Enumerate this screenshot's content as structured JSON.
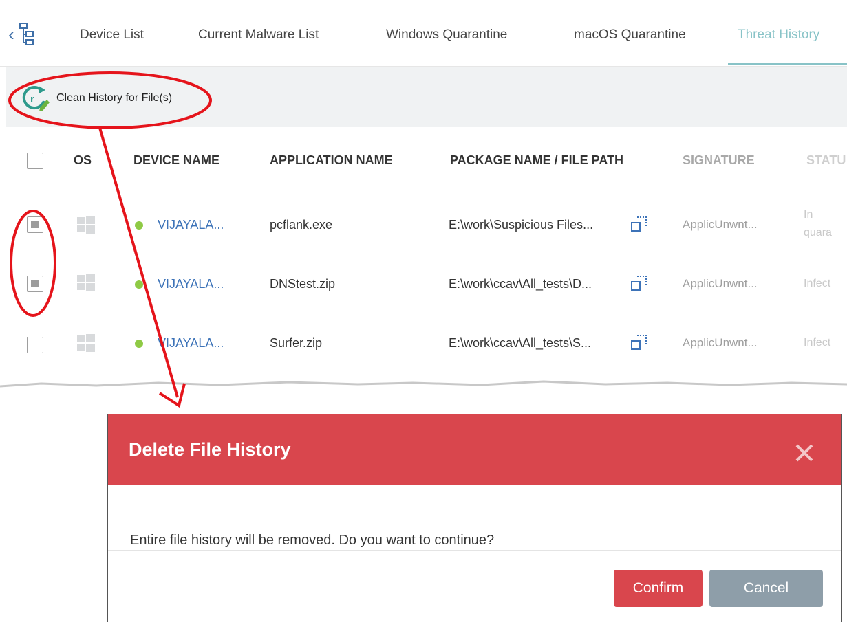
{
  "tabs": [
    {
      "label": "Device List",
      "active": false
    },
    {
      "label": "Current Malware List",
      "active": false
    },
    {
      "label": "Windows Quarantine",
      "active": false
    },
    {
      "label": "macOS Quarantine",
      "active": false
    },
    {
      "label": "Threat History",
      "active": true
    }
  ],
  "toolbar": {
    "clean_label": "Clean History for File(s)"
  },
  "table": {
    "headers": {
      "os": "OS",
      "device": "DEVICE NAME",
      "app": "APPLICATION NAME",
      "path": "PACKAGE NAME / FILE PATH",
      "signature": "SIGNATURE",
      "status": "STATU"
    },
    "rows": [
      {
        "checked": true,
        "device": "VIJAYALA...",
        "app": "pcflank.exe",
        "path": "E:\\work\\Suspicious Files...",
        "signature": "ApplicUnwnt...",
        "status_line1": "In",
        "status_line2": "quara"
      },
      {
        "checked": true,
        "device": "VIJAYALA...",
        "app": "DNStest.zip",
        "path": "E:\\work\\ccav\\All_tests\\D...",
        "signature": "ApplicUnwnt...",
        "status_line1": "Infect"
      },
      {
        "checked": false,
        "device": "VIJAYALA...",
        "app": "Surfer.zip",
        "path": "E:\\work\\ccav\\All_tests\\S...",
        "signature": "ApplicUnwnt...",
        "status_line1": "Infect"
      }
    ]
  },
  "dialog": {
    "title": "Delete File History",
    "message": "Entire file history will be removed. Do you want to continue?",
    "confirm_label": "Confirm",
    "cancel_label": "Cancel"
  },
  "colors": {
    "accent_tab": "#88c3c7",
    "dialog_header": "#d9464d",
    "confirm": "#d9464d",
    "cancel": "#8e9ea9",
    "link": "#3d73b8",
    "online_dot": "#8fca45",
    "annotation": "#e5141b"
  },
  "icons": [
    "hierarchy-tree-icon",
    "chevron-left-icon",
    "clean-history-icon",
    "windows-logo-icon",
    "expand-path-icon",
    "close-icon"
  ]
}
